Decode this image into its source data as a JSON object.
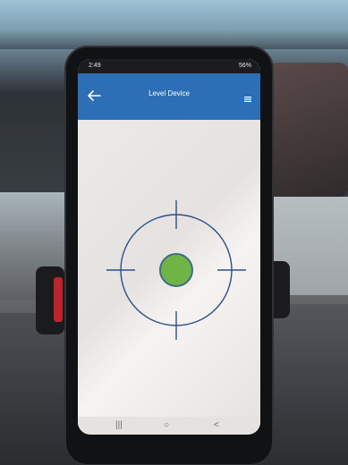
{
  "status_bar": {
    "time": "2:49",
    "right_text": "56%"
  },
  "app_bar": {
    "title": "Level Device",
    "back_icon": "arrow-left-icon",
    "menu_icon": "menu-icon"
  },
  "level": {
    "bubble_color": "#6fb546",
    "crosshair_color": "#2a4f8f"
  },
  "nav": {
    "recent": "|||",
    "home": "○",
    "back": "<"
  }
}
